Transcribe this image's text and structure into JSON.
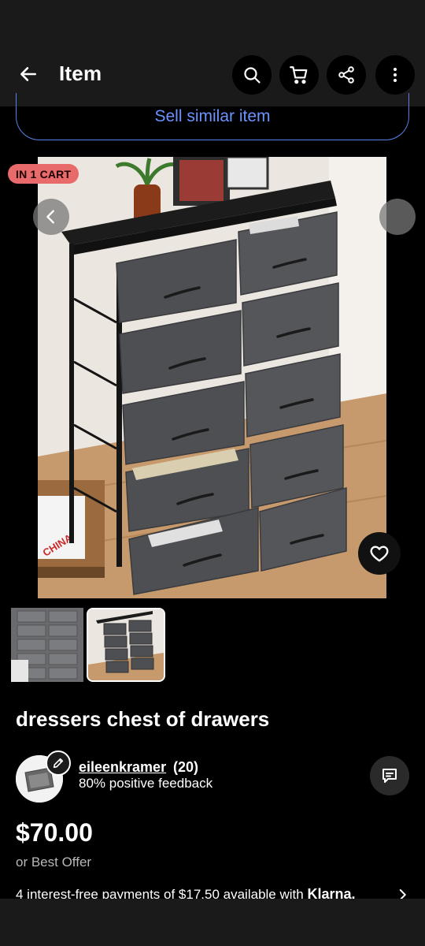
{
  "header": {
    "title": "Item",
    "back_icon": "arrow-left-icon",
    "actions": [
      "search-icon",
      "cart-icon",
      "share-icon",
      "more-vertical-icon"
    ]
  },
  "sell_similar": {
    "label": "Sell similar item"
  },
  "gallery": {
    "cart_badge": "IN 1 CART",
    "thumbnail_count": 2,
    "selected_thumbnail": 2
  },
  "item": {
    "title": "dressers chest of drawers",
    "price": "$70.00",
    "offer_text": "or Best Offer",
    "installments_text": "4 interest-free payments of $17.50 available with",
    "installments_brand": "Klarna."
  },
  "seller": {
    "name": "eileenkramer",
    "rating_count": "(20)",
    "feedback": "80% positive feedback"
  },
  "colors": {
    "accent_link": "#6d93ff",
    "badge": "#e86a6a",
    "bar_bg": "#1a1a1a",
    "page_bg": "#000000"
  }
}
